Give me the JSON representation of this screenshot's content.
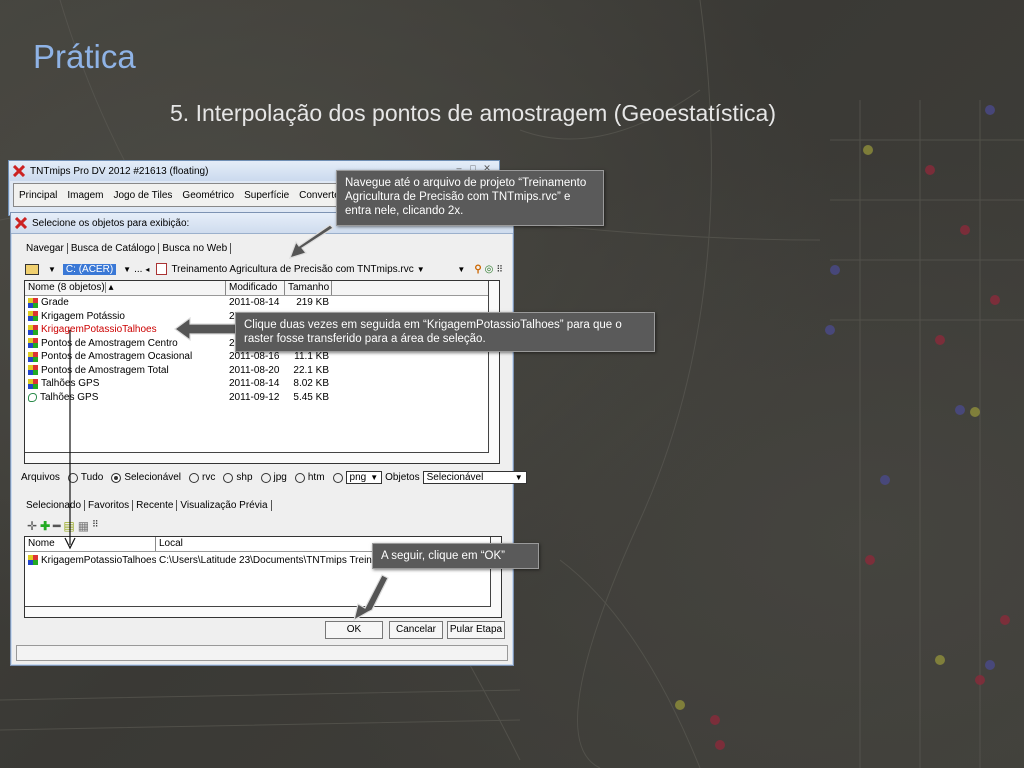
{
  "slide": {
    "title": "Prática",
    "subtitle": "5. Interpolação dos pontos de amostragem (Geoestatística)"
  },
  "main_window": {
    "title": "TNTmips Pro DV 2012  #21613 (floating)",
    "menu": [
      "Principal",
      "Imagem",
      "Jogo de Tiles",
      "Geométrico",
      "Superfície",
      "Converter"
    ]
  },
  "dialog": {
    "title": "Selecione os objetos para exibição:",
    "tabs": [
      "Navegar",
      "Busca de Catálogo",
      "Busca no Web"
    ],
    "path": {
      "drive": "C: (ACER)",
      "ellipsis": "...",
      "file": "Treinamento Agricultura de Precisão com TNTmips.rvc"
    },
    "file_list": {
      "columns": [
        "Nome  (8 objetos)",
        "Modificado",
        "Tamanho"
      ],
      "rows": [
        {
          "name": "Grade",
          "modified": "2011-08-14",
          "size": "219 KB",
          "type": "raster"
        },
        {
          "name": "Krigagem Potássio",
          "modified": "2",
          "size": "",
          "type": "raster"
        },
        {
          "name": "KrigagemPotassioTalhoes",
          "modified": "2",
          "size": "",
          "type": "raster",
          "highlight": true
        },
        {
          "name": "Pontos de Amostragem Centro",
          "modified": "2",
          "size": "",
          "type": "raster"
        },
        {
          "name": "Pontos de Amostragem Ocasional",
          "modified": "2011-08-16",
          "size": "11.1 KB",
          "type": "raster"
        },
        {
          "name": "Pontos de Amostragem Total",
          "modified": "2011-08-20",
          "size": "22.1 KB",
          "type": "raster"
        },
        {
          "name": "Talhões GPS",
          "modified": "2011-08-14",
          "size": "8.02 KB",
          "type": "raster"
        },
        {
          "name": "Talhões GPS",
          "modified": "2011-09-12",
          "size": "5.45 KB",
          "type": "vector"
        }
      ]
    },
    "filter": {
      "arquivos_label": "Arquivos",
      "options": [
        "Tudo",
        "Selecionável",
        "rvc",
        "shp",
        "jpg",
        "htm"
      ],
      "selected_option": "Selecionável",
      "format_value": "png",
      "objetos_label": "Objetos",
      "objetos_value": "Selecionável"
    },
    "selection_tabs": [
      "Selecionado",
      "Favoritos",
      "Recente",
      "Visualização Prévia"
    ],
    "selected_list": {
      "columns": [
        "Nome",
        "Local"
      ],
      "rows": [
        {
          "name": "KrigagemPotassioTalhoes",
          "location": "C:\\Users\\Latitude 23\\Documents\\TNTmips Treinam"
        }
      ]
    },
    "buttons": {
      "ok": "OK",
      "cancel": "Cancelar",
      "skip": "Pular Etapa"
    }
  },
  "callouts": {
    "navigate": "Navegue até o arquivo de projeto “Treinamento Agricultura de Precisão com TNTmips.rvc” e entra nele, clicando 2x.",
    "double_click": "Clique duas vezes em seguida em “KrigagemPotassioTalhoes” para que o raster fosse transferido para a área de seleção.",
    "ok": "A seguir, clique em “OK”"
  },
  "colors": {
    "title_blue": "#8fb3e6",
    "callout_bg": "#5a5a5a",
    "highlight_red": "#cc0000",
    "drive_blue": "#3a78d6"
  }
}
